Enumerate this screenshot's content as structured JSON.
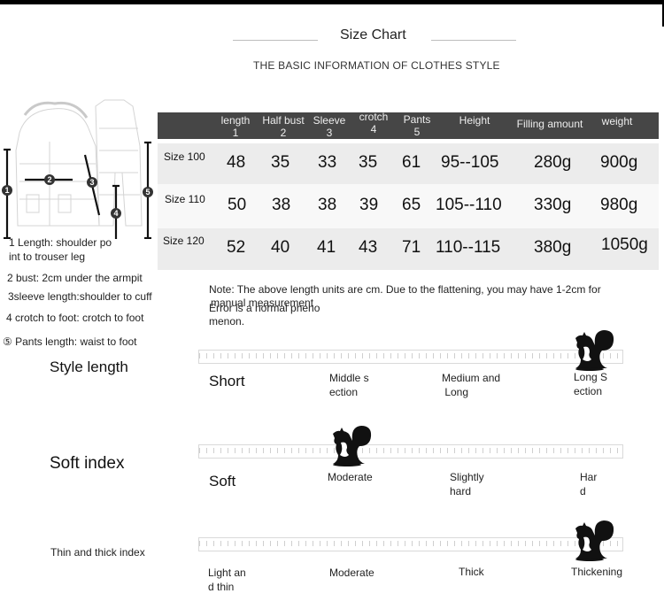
{
  "header": {
    "title": "Size Chart",
    "subtitle": "THE BASIC INFORMATION OF CLOTHES STYLE"
  },
  "table": {
    "columns": [
      {
        "line1": "length",
        "line2": "1"
      },
      {
        "line1": "Half bust",
        "line2": "2"
      },
      {
        "line1": "Sleeve",
        "line2": "3"
      },
      {
        "line1": "crotch",
        "line2": "4"
      },
      {
        "line1": "Pants",
        "line2": "5"
      },
      {
        "line1": "Height",
        "line2": ""
      },
      {
        "line1": "Filling amount",
        "line2": ""
      },
      {
        "line1": "weight",
        "line2": ""
      }
    ],
    "rows": [
      {
        "size": "Size 100",
        "values": [
          "48",
          "35",
          "33",
          "35",
          "61",
          "95--105",
          "280g",
          "900g"
        ]
      },
      {
        "size": "Size 110",
        "values": [
          "50",
          "38",
          "38",
          "39",
          "65",
          "105--110",
          "330g",
          "980g"
        ]
      },
      {
        "size": "Size 120",
        "values": [
          "52",
          "40",
          "41",
          "43",
          "71",
          "110--115",
          "380g",
          "1050g"
        ]
      }
    ]
  },
  "measure_legend": {
    "markers": [
      "1",
      "2",
      "3",
      "4",
      "5"
    ],
    "items": [
      "1 Length: shoulder po",
      "int to trouser leg",
      "2 bust: 2cm under the armpit",
      "3sleeve length:shoulder to cuff",
      "4 crotch to foot: crotch to foot",
      "⑤ Pants length: waist to foot"
    ]
  },
  "note": {
    "line1": "Note: The above length units are cm. Due to the flattening, you may have 1-2cm for",
    "line2": "manual measurement",
    "line3": "Error is a normal pheno",
    "line4": "menon."
  },
  "scales": [
    {
      "title": "Style length",
      "labels": [
        "Short",
        "Middle s\nection",
        "Medium and\n Long",
        "Long S\nection"
      ],
      "selected_index": 3,
      "selected_position": 0.95
    },
    {
      "title": "Soft index",
      "labels": [
        "Soft",
        "Moderate",
        "Slightly\nhard",
        "Har\nd"
      ],
      "selected_index": 1,
      "selected_position": 0.36
    },
    {
      "title": "Thin and thick index",
      "labels": [
        "Light an\nd thin",
        "Moderate",
        "Thick",
        "Thickening"
      ],
      "selected_index": 3,
      "selected_position": 0.95
    }
  ]
}
